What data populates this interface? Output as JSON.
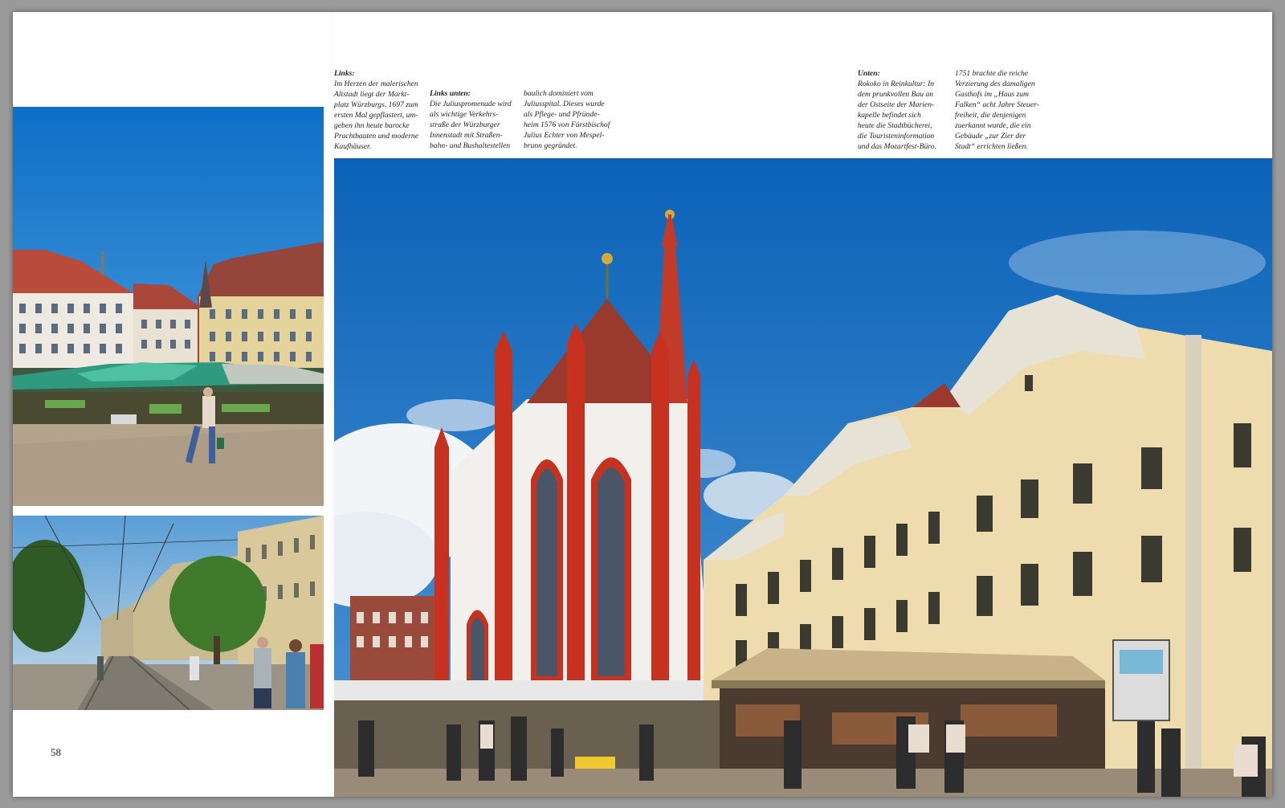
{
  "page_number": "58",
  "captions": {
    "links": {
      "heading": "Links:",
      "text": "Im Herzen der malerischen\nAltstadt liegt der Markt-\nplatz Würzburgs. 1697 zum\nersten Mal gepflastert, um-\ngeben ihn heute barocke\nPrachtbauten und moderne\nKaufhäuser."
    },
    "links_unten": {
      "heading": "Links unten:",
      "text": "Die Juliuspromenade wird\nals wichtige Verkehrs-\nstraße der Würzburger\nInnenstadt mit Straßen-\nbahn- und Bushaltestellen"
    },
    "links_unten_cont": {
      "text": "baulich dominiert vom\nJuliusspital. Dieses wurde\nals Pflege- und Pfründe-\nheim 1576 von Fürstbischof\nJulius Echter von Mespel-\nbrunn gegründet."
    },
    "unten": {
      "heading": "Unten:",
      "text": "Rokoko in Reinkultur: In\ndem prunkvollen Bau an\nder Ostseite der Marien-\nkapelle befindet sich\nheute die Stadtbücherei,\ndie Touristeninformation\nund das Mozartfest-Büro."
    },
    "unten_cont": {
      "text": "1751 brachte die reiche\nVerzierung des damaligen\nGasthofs im „Haus zum\nFalken“ acht Jahre Steuer-\nfreiheit, die denjenigen\nzuerkannt wurde, die ein\nGebäude „zur Zier der\nStadt“ errichten ließen."
    }
  },
  "photos": {
    "marketplace": {
      "subject": "Marktplatz Würzburg"
    },
    "juliuspromenade": {
      "subject": "Juliuspromenade"
    },
    "marienkapelle": {
      "subject": "Marienkapelle und Haus zum Falken"
    }
  },
  "colors": {
    "sky": "#1f78c8",
    "chapel_red": "#c93a2a",
    "facade_cream": "#efdcae",
    "page": "#ffffff"
  }
}
